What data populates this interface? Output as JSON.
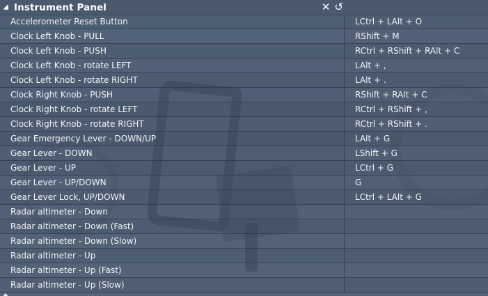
{
  "panel": {
    "title": "Instrument Panel",
    "close_icon": "close-icon",
    "reset_icon": "reset-icon",
    "close_glyph": "✕",
    "reset_glyph": "↺"
  },
  "bindings": [
    {
      "action": "Accelerometer Reset Button",
      "key": "LCtrl + LAlt + O"
    },
    {
      "action": "Clock Left Knob - PULL",
      "key": "RShift + M"
    },
    {
      "action": "Clock Left Knob - PUSH",
      "key": "RCtrl + RShift + RAlt + C"
    },
    {
      "action": "Clock Left Knob - rotate LEFT",
      "key": "LAlt + ,"
    },
    {
      "action": "Clock Left Knob - rotate RIGHT",
      "key": "LAlt + ."
    },
    {
      "action": "Clock Right Knob - PUSH",
      "key": "RShift + RAlt + C"
    },
    {
      "action": "Clock Right Knob - rotate LEFT",
      "key": "RCtrl + RShift + ,"
    },
    {
      "action": "Clock Right Knob - rotate RIGHT",
      "key": "RCtrl + RShift + ."
    },
    {
      "action": "Gear Emergency Lever - DOWN/UP",
      "key": "LAlt + G"
    },
    {
      "action": "Gear Lever - DOWN",
      "key": "LShift + G"
    },
    {
      "action": "Gear Lever - UP",
      "key": "LCtrl + G"
    },
    {
      "action": "Gear Lever - UP/DOWN",
      "key": "G"
    },
    {
      "action": "Gear Lever Lock, UP/DOWN",
      "key": "LCtrl + LAlt + G"
    },
    {
      "action": "Radar altimeter - Down",
      "key": ""
    },
    {
      "action": "Radar altimeter - Down (Fast)",
      "key": ""
    },
    {
      "action": "Radar altimeter - Down (Slow)",
      "key": ""
    },
    {
      "action": "Radar altimeter - Up",
      "key": ""
    },
    {
      "action": "Radar altimeter - Up (Fast)",
      "key": ""
    },
    {
      "action": "Radar altimeter - Up (Slow)",
      "key": ""
    }
  ]
}
